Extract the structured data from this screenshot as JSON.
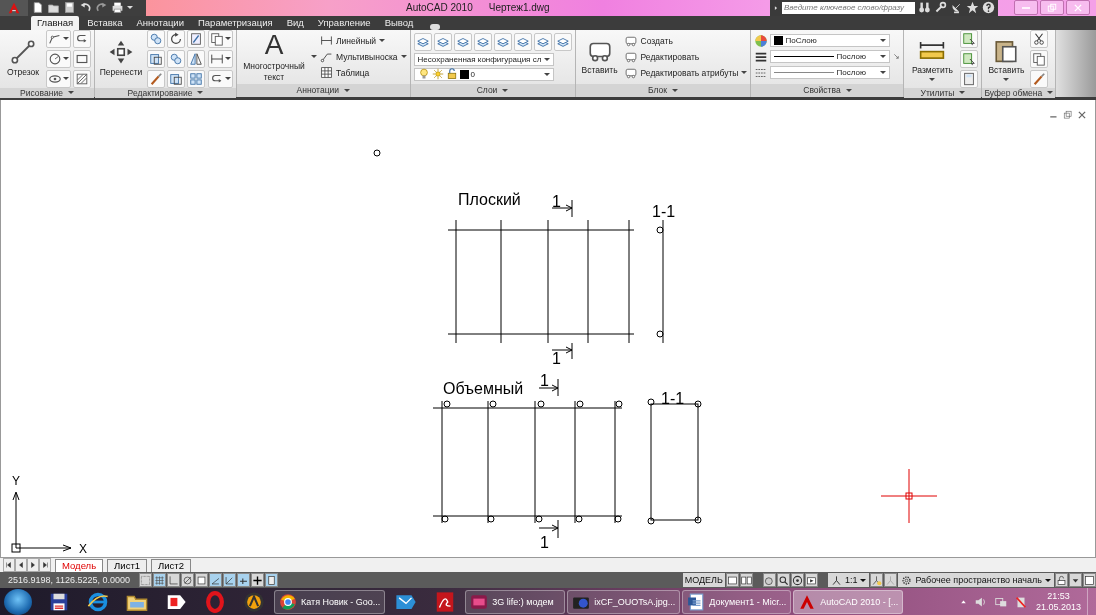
{
  "title_bar": {
    "app_name": "AutoCAD 2010",
    "file_name": "Чертеж1.dwg",
    "search": {
      "placeholder": "Введите ключевое слово/фразу"
    }
  },
  "ribbon_tabs": [
    {
      "label": "Главная",
      "selected": true
    },
    {
      "label": "Вставка",
      "selected": false
    },
    {
      "label": "Аннотации",
      "selected": false
    },
    {
      "label": "Параметризация",
      "selected": false
    },
    {
      "label": "Вид",
      "selected": false
    },
    {
      "label": "Управление",
      "selected": false
    },
    {
      "label": "Вывод",
      "selected": false
    }
  ],
  "ribbon_panels": [
    {
      "kind": "draw",
      "title": "Рисование",
      "big_button": "Отрезок"
    },
    {
      "kind": "modify",
      "title": "Редактирование",
      "big_button": "Перенести"
    },
    {
      "kind": "annotate",
      "title": "Аннотации",
      "icon_glyph": "A",
      "big_button": "Многострочный текст",
      "items": [
        "Линейный",
        "Мультивыноска",
        "Таблица"
      ]
    },
    {
      "kind": "layers",
      "title": "Слои",
      "dropdowns": [
        "Несохраненная конфигурация сл",
        "0"
      ]
    },
    {
      "kind": "block",
      "title": "Блок",
      "big_button": "Вставить",
      "items": [
        "Создать",
        "Редактировать",
        "Редактировать атрибуты"
      ]
    },
    {
      "kind": "properties",
      "title": "Свойства",
      "dropdowns": [
        "ПоСлою",
        "Послою",
        "Послою"
      ]
    },
    {
      "kind": "utilities",
      "title": "Утилиты",
      "big_button": "Разметить"
    },
    {
      "kind": "clipboard",
      "title": "Буфер обмена",
      "big_button": "Вставить"
    }
  ],
  "drawing": {
    "views": [
      {
        "kind": "flat",
        "title": "Плоский",
        "cut_marks": [
          "1",
          "1"
        ],
        "section_label": "1-1"
      },
      {
        "kind": "volume",
        "title": "Объемный",
        "cut_marks": [
          "1",
          "1"
        ],
        "section_label": "1-1"
      }
    ],
    "ucs": {
      "x_label": "X",
      "y_label": "Y"
    }
  },
  "layout_tabs": [
    {
      "label": "Модель",
      "selected": true
    },
    {
      "label": "Лист1",
      "selected": false
    },
    {
      "label": "Лист2",
      "selected": false
    }
  ],
  "status_bar": {
    "coordinates": "2516.9198, 1126.5225, 0.0000",
    "toggles": [
      {
        "on": false
      },
      {
        "on": true
      },
      {
        "on": false
      },
      {
        "on": false
      },
      {
        "on": false
      },
      {
        "on": true
      },
      {
        "on": true
      },
      {
        "on": true
      },
      {
        "on": false
      },
      {
        "on": true
      }
    ],
    "space": "МОДЕЛЬ",
    "scale": "1:1",
    "workspace": "Рабочее пространство началь"
  },
  "taskbar": {
    "tasks": [
      {
        "label": "Катя Новик - Goo...",
        "selected": false
      },
      {
        "label": "3G life:) модем",
        "selected": false
      },
      {
        "label": "ixCF_OUOTsA.jpg...",
        "selected": false
      },
      {
        "label": "Документ1 - Micr...",
        "selected": false
      },
      {
        "label": "AutoCAD 2010 - [...",
        "selected": true
      }
    ],
    "clock": {
      "time": "21:53",
      "date": "21.05.2013"
    }
  }
}
